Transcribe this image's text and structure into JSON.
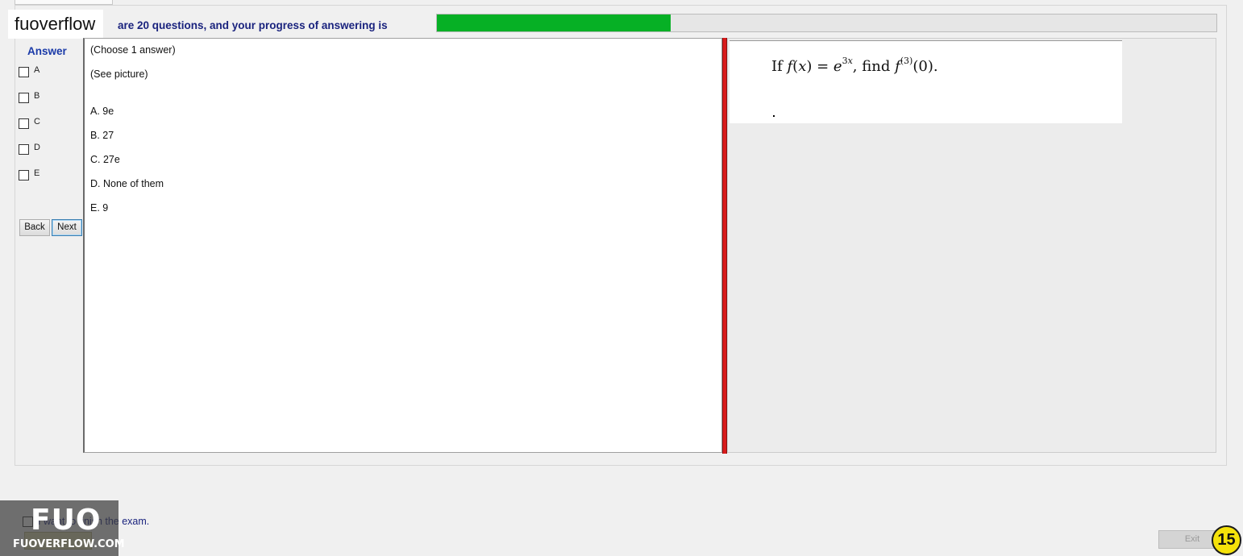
{
  "brand": "fuoverflow",
  "progress": {
    "label": "are 20 questions, and your progress of answering is",
    "fraction": 0.3,
    "fill_color": "#06b025"
  },
  "answer_panel": {
    "title": "Answer",
    "options": [
      "A",
      "B",
      "C",
      "D",
      "E"
    ],
    "back_label": "Back",
    "next_label": "Next"
  },
  "question": {
    "instruction": "(Choose 1 answer)",
    "note": "(See picture)",
    "choices": [
      "A.  9e",
      "B.  27",
      "C.  27e",
      "D.  None of them",
      "E.  9"
    ]
  },
  "picture": {
    "formula_text": "If f(x) = e^{3x}, find f^{(3)}(0)."
  },
  "footer": {
    "finish_label": "I want to finish the exam.",
    "exit_label": "Exit",
    "counter": "15"
  },
  "watermark": {
    "logo_big": "FUO",
    "logo_small": "FUOVERFLOW.COM"
  },
  "colors": {
    "divider": "#d81b1b",
    "answer_title": "#1a3aa8",
    "progress_text": "#1a237e",
    "counter_badge": "#f5e20a"
  }
}
